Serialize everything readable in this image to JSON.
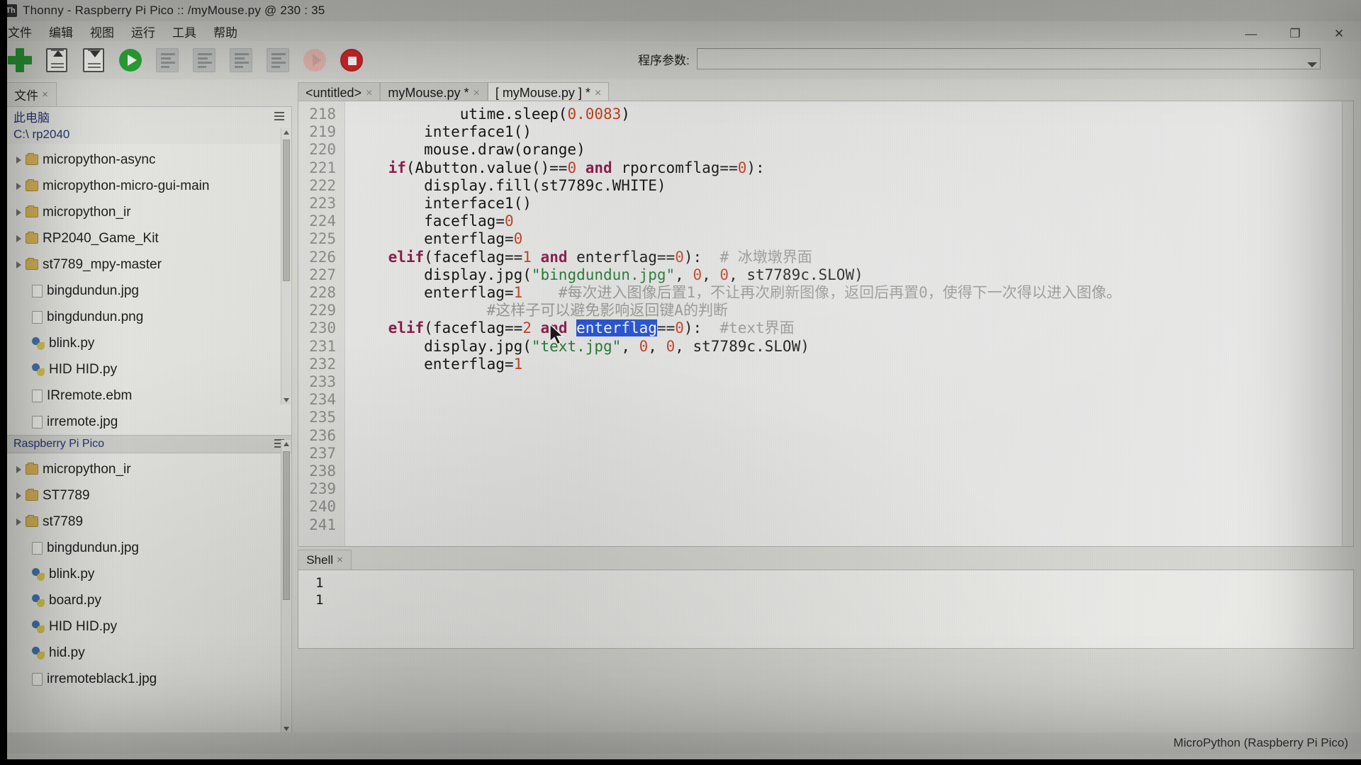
{
  "window": {
    "title": "Thonny  -  Raspberry Pi Pico :: /myMouse.py  @  230 : 35",
    "app_icon": "thonny-icon",
    "minimize": "—",
    "maximize": "❐",
    "close": "✕"
  },
  "menu": {
    "items": [
      {
        "label": "文件"
      },
      {
        "label": "编辑"
      },
      {
        "label": "视图"
      },
      {
        "label": "运行"
      },
      {
        "label": "工具"
      },
      {
        "label": "帮助"
      }
    ]
  },
  "toolbar": {
    "buttons": [
      {
        "name": "new-file-button",
        "icon": "plus-icon"
      },
      {
        "name": "open-file-button",
        "icon": "open-document-icon"
      },
      {
        "name": "save-file-button",
        "icon": "save-document-icon"
      },
      {
        "name": "run-button",
        "icon": "play-icon"
      },
      {
        "name": "debug-button",
        "icon": "step-icon"
      },
      {
        "name": "step-over-button",
        "icon": "step-icon"
      },
      {
        "name": "step-into-button",
        "icon": "step-icon"
      },
      {
        "name": "step-out-button",
        "icon": "step-icon"
      },
      {
        "name": "resume-button",
        "icon": "resume-icon"
      },
      {
        "name": "stop-button",
        "icon": "stop-icon"
      }
    ],
    "args_label": "程序参数:",
    "args_value": "",
    "args_placeholder": ""
  },
  "files_panel": {
    "tab_label": "文件",
    "tab_close": "×",
    "this_computer": {
      "header": "此电脑",
      "path": "C:\\ rp2040",
      "items": [
        {
          "label": "micropython-async",
          "type": "folder",
          "expandable": true
        },
        {
          "label": "micropython-micro-gui-main",
          "type": "folder",
          "expandable": true
        },
        {
          "label": "micropython_ir",
          "type": "folder",
          "expandable": true
        },
        {
          "label": "RP2040_Game_Kit",
          "type": "folder",
          "expandable": true
        },
        {
          "label": "st7789_mpy-master",
          "type": "folder",
          "expandable": true
        },
        {
          "label": "bingdundun.jpg",
          "type": "file",
          "expandable": false
        },
        {
          "label": "bingdundun.png",
          "type": "file",
          "expandable": false
        },
        {
          "label": "blink.py",
          "type": "python",
          "expandable": false
        },
        {
          "label": "HID HID.py",
          "type": "python",
          "expandable": false
        },
        {
          "label": "IRremote.ebm",
          "type": "file",
          "expandable": false
        },
        {
          "label": "irremote.jpg",
          "type": "file",
          "expandable": false
        }
      ]
    },
    "device": {
      "header": "Raspberry Pi Pico",
      "items": [
        {
          "label": "micropython_ir",
          "type": "folder",
          "expandable": true
        },
        {
          "label": "ST7789",
          "type": "folder",
          "expandable": true
        },
        {
          "label": "st7789",
          "type": "folder",
          "expandable": true
        },
        {
          "label": "bingdundun.jpg",
          "type": "file",
          "expandable": false
        },
        {
          "label": "blink.py",
          "type": "python",
          "expandable": false
        },
        {
          "label": "board.py",
          "type": "python",
          "expandable": false
        },
        {
          "label": "HID HID.py",
          "type": "python",
          "expandable": false
        },
        {
          "label": "hid.py",
          "type": "python",
          "expandable": false
        },
        {
          "label": "irremoteblack1.jpg",
          "type": "file",
          "expandable": false
        }
      ]
    }
  },
  "editor": {
    "tabs": [
      {
        "label": "<untitled>",
        "close": "×",
        "active": false,
        "modified": false
      },
      {
        "label": "myMouse.py *",
        "close": "×",
        "active": false,
        "modified": true
      },
      {
        "label": "[ myMouse.py ] *",
        "close": "×",
        "active": true,
        "modified": true
      }
    ],
    "first_line_number": 218,
    "last_line_number": 241,
    "line_numbers": [
      218,
      219,
      220,
      221,
      222,
      223,
      224,
      225,
      226,
      227,
      228,
      229,
      230,
      231,
      232,
      233,
      234,
      235,
      236,
      237,
      238,
      239,
      240,
      241
    ],
    "selection_text": "enterflag",
    "selection_line": 230,
    "lines": [
      {
        "n": 218,
        "text": "            utime.sleep(0.0083)"
      },
      {
        "n": 219,
        "text": "        interface1()"
      },
      {
        "n": 220,
        "text": "        mouse.draw(orange)"
      },
      {
        "n": 221,
        "text": "    if(Abutton.value()==0 and rporcomflag==0):"
      },
      {
        "n": 222,
        "text": "        display.fill(st7789c.WHITE)"
      },
      {
        "n": 223,
        "text": "        interface1()"
      },
      {
        "n": 224,
        "text": "        faceflag=0"
      },
      {
        "n": 225,
        "text": "        enterflag=0"
      },
      {
        "n": 226,
        "text": "    elif(faceflag==1 and enterflag==0):  # 冰墩墩界面"
      },
      {
        "n": 227,
        "text": "        display.jpg(\"bingdundun.jpg\", 0, 0, st7789c.SLOW)"
      },
      {
        "n": 228,
        "text": "        enterflag=1    #每次进入图像后置1，不让再次刷新图像，返回后再置0，使得下一次得以进入图像。"
      },
      {
        "n": 229,
        "text": "               #这样子可以避免影响返回键A的判断"
      },
      {
        "n": 230,
        "text": "    elif(faceflag==2 and enterflag==0):  #text界面"
      },
      {
        "n": 231,
        "text": "        display.jpg(\"text.jpg\", 0, 0, st7789c.SLOW)"
      },
      {
        "n": 232,
        "text": "        enterflag=1"
      },
      {
        "n": 233,
        "text": ""
      },
      {
        "n": 234,
        "text": ""
      },
      {
        "n": 235,
        "text": ""
      },
      {
        "n": 236,
        "text": ""
      },
      {
        "n": 237,
        "text": ""
      },
      {
        "n": 238,
        "text": ""
      },
      {
        "n": 239,
        "text": ""
      },
      {
        "n": 240,
        "text": ""
      },
      {
        "n": 241,
        "text": ""
      }
    ]
  },
  "shell": {
    "tab_label": "Shell",
    "tab_close": "×",
    "output_lines": [
      "1",
      "1"
    ]
  },
  "statusbar": {
    "interpreter": "MicroPython (Raspberry Pi Pico)"
  },
  "colors": {
    "keyword": "#8b1a4a",
    "number": "#c4411f",
    "string": "#1f7a2e",
    "comment": "#9a9a97",
    "selection_bg": "#1e4fd8",
    "run_green": "#1fa32b",
    "stop_red": "#cf1f22",
    "plus_green": "#1d8f28",
    "panel_bg": "#e6e6e2",
    "chrome_bg": "#d2d2ce"
  }
}
